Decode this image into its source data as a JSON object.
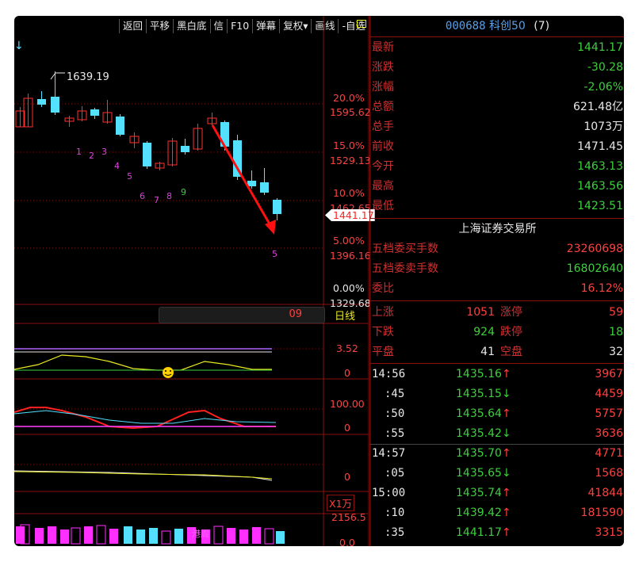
{
  "toolbar": {
    "items": [
      "返回",
      "平移",
      "黑白底",
      "信",
      "F10",
      "弹幕",
      "复权▾",
      "画线",
      "-自选"
    ]
  },
  "chart": {
    "peak_label": "1639.19",
    "pct_labels": [
      "20.0%",
      "15.0%",
      "10.0%",
      "5.00%",
      "0.00%"
    ],
    "price_labels": [
      "1595.62",
      "1529.13",
      "1462.65",
      "1396.16",
      "1329.68"
    ],
    "current_price_tag": "1441.17",
    "period_value": "09",
    "period_label": "日线",
    "count_labels": [
      "1",
      "2",
      "3",
      "4",
      "5",
      "6",
      "7",
      "8",
      "9"
    ],
    "count_label_end": "5",
    "ind1_labels": [
      "3.52",
      "0"
    ],
    "ind2_labels": [
      "100.00",
      "0"
    ],
    "ind3_labels": [
      "0"
    ],
    "vol_unit": "X1万",
    "vol_labels": [
      "2156.5",
      "0.0"
    ],
    "vol_overlay_text": "港周"
  },
  "quote": {
    "title_code": "000688",
    "title_name": "科创50",
    "title_count": "(7)",
    "rows": [
      {
        "label": "最新",
        "value": "1441.17",
        "color": "green"
      },
      {
        "label": "涨跌",
        "value": "-30.28",
        "color": "green"
      },
      {
        "label": "涨幅",
        "value": "-2.06%",
        "color": "green"
      },
      {
        "label": "总额",
        "value": "621.48亿",
        "color": "white"
      },
      {
        "label": "总手",
        "value": "1073万",
        "color": "white"
      },
      {
        "label": "前收",
        "value": "1471.45",
        "color": "white"
      },
      {
        "label": "今开",
        "value": "1463.13",
        "color": "green"
      },
      {
        "label": "最高",
        "value": "1463.56",
        "color": "green"
      },
      {
        "label": "最低",
        "value": "1423.51",
        "color": "green"
      }
    ],
    "exchange": "上海证券交易所",
    "book": [
      {
        "label": "五档委买手数",
        "value": "23260698",
        "color": "red"
      },
      {
        "label": "五档委卖手数",
        "value": "16802640",
        "color": "green"
      },
      {
        "label": "委比",
        "value": "16.12%",
        "color": "red"
      }
    ],
    "breadth": [
      {
        "l1": "上涨",
        "v1": "1051",
        "c1": "red",
        "l2": "涨停",
        "v2": "59",
        "c2": "red"
      },
      {
        "l1": "下跌",
        "v1": "924",
        "c1": "green",
        "l2": "跌停",
        "v2": "18",
        "c2": "green"
      },
      {
        "l1": "平盘",
        "v1": "41",
        "c1": "white",
        "l2": "空盘",
        "v2": "32",
        "c2": "white"
      }
    ],
    "ticks": [
      {
        "time": "14:56",
        "price": "1435.16",
        "dir": "↑",
        "vol": "3967"
      },
      {
        "time": ":45",
        "price": "1435.15",
        "dir": "↓",
        "vol": "4459"
      },
      {
        "time": ":50",
        "price": "1435.64",
        "dir": "↑",
        "vol": "5757"
      },
      {
        "time": ":55",
        "price": "1435.42",
        "dir": "↓",
        "vol": "3636"
      },
      {
        "time": "14:57",
        "price": "1435.70",
        "dir": "↑",
        "vol": "4771"
      },
      {
        "time": ":05",
        "price": "1435.65",
        "dir": "↓",
        "vol": "1568"
      },
      {
        "time": "15:00",
        "price": "1435.74",
        "dir": "↑",
        "vol": "41844"
      },
      {
        "time": ":10",
        "price": "1439.42",
        "dir": "↑",
        "vol": "181590"
      },
      {
        "time": ":35",
        "price": "1441.17",
        "dir": "↑",
        "vol": "3315"
      }
    ]
  }
}
